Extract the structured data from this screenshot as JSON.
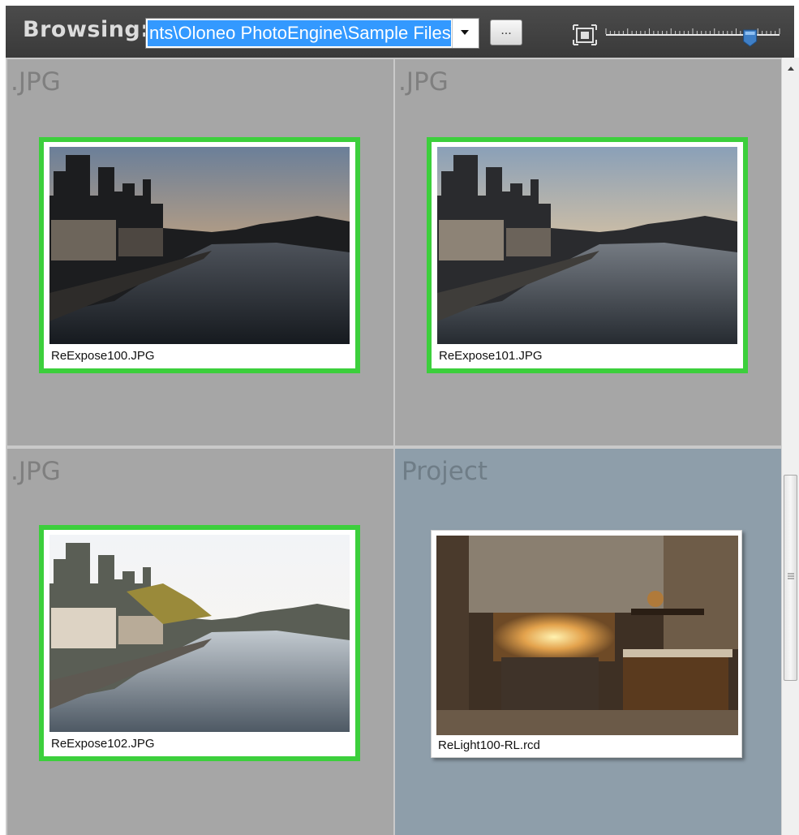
{
  "toolbar": {
    "browsing_label": "Browsing:",
    "path_value": "nts\\Oloneo PhotoEngine\\Sample Files\\",
    "browse_button_label": "...",
    "fit_icon": "fit-to-window-icon",
    "zoom_slider_level": 0.83
  },
  "groups": [
    {
      "title": ".JPG",
      "file": {
        "name": "ReExpose100.JPG",
        "selected": true,
        "photo": "river-dusk-dark"
      }
    },
    {
      "title": ".JPG",
      "file": {
        "name": "ReExpose101.JPG",
        "selected": true,
        "photo": "river-dusk-medium"
      }
    },
    {
      "title": ".JPG",
      "file": {
        "name": "ReExpose102.JPG",
        "selected": true,
        "photo": "river-dusk-bright"
      }
    },
    {
      "title": "Project",
      "file": {
        "name": "ReLight100-RL.rcd",
        "selected": false,
        "photo": "kitchen-fireplace"
      }
    }
  ],
  "colors": {
    "selection_border": "#3ccf3c",
    "cell_background": "#a6a6a6",
    "project_background": "#8e9eaa",
    "path_highlight": "#3399ff"
  },
  "scrollbar": {
    "icons": [
      "scroll-up-arrow-icon",
      "scroll-grip-icon"
    ]
  }
}
